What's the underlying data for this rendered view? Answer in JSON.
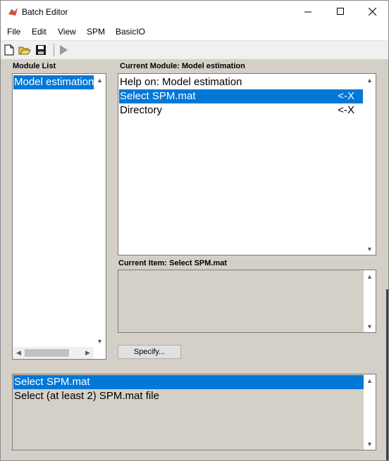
{
  "window": {
    "title": "Batch Editor"
  },
  "menu": [
    "File",
    "Edit",
    "View",
    "SPM",
    "BasicIO"
  ],
  "toolbar": {
    "icons": [
      "new-file-icon",
      "open-folder-icon",
      "save-icon",
      "run-icon"
    ]
  },
  "module_list": {
    "label": "Module List",
    "items": [
      {
        "label": "Model estimation",
        "selected": true
      }
    ]
  },
  "current_module": {
    "label": "Current Module: Model estimation",
    "items": [
      {
        "label": "Help on: Model estimation",
        "tag": "",
        "selected": false
      },
      {
        "label": "Select SPM.mat",
        "tag": "<-X",
        "selected": true
      },
      {
        "label": "Directory",
        "tag": "<-X",
        "selected": false
      }
    ]
  },
  "current_item": {
    "label": "Current Item: Select SPM.mat",
    "button": "Specify..."
  },
  "help_box": {
    "lines": [
      {
        "text": "Select SPM.mat",
        "selected": true
      },
      {
        "text": "Select (at least 2) SPM.mat file",
        "selected": false
      }
    ]
  },
  "colors": {
    "selection": "#0078d7",
    "panel": "#d4d0c8"
  }
}
